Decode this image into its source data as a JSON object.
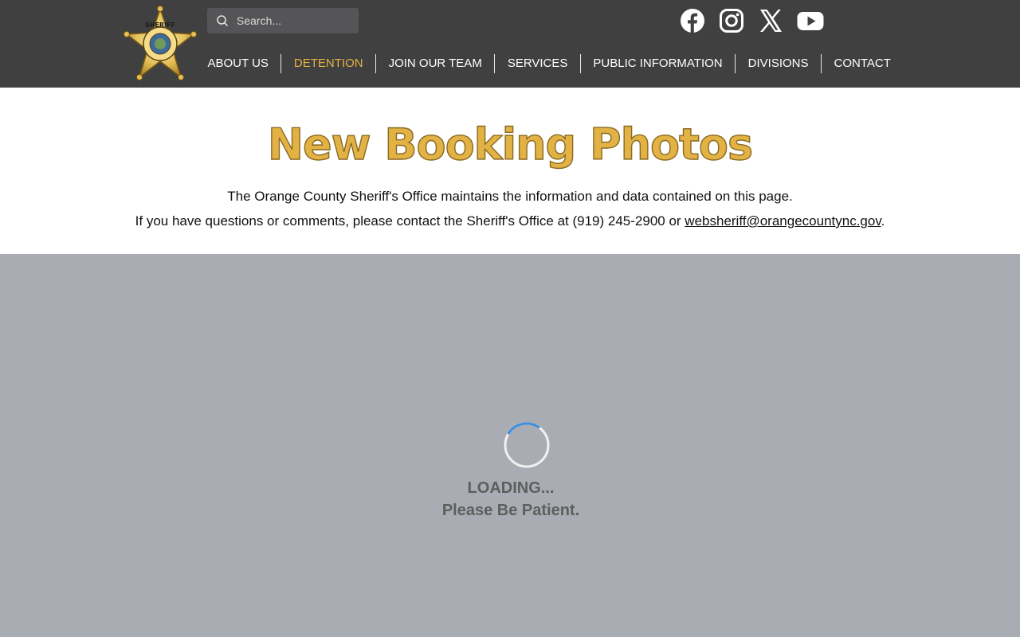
{
  "header": {
    "search": {
      "placeholder": "Search..."
    },
    "social": [
      "facebook-icon",
      "instagram-icon",
      "x-icon",
      "youtube-icon"
    ],
    "nav": [
      {
        "label": "ABOUT US",
        "active": false
      },
      {
        "label": "DETENTION",
        "active": true
      },
      {
        "label": "JOIN OUR TEAM",
        "active": false
      },
      {
        "label": "SERVICES",
        "active": false
      },
      {
        "label": "PUBLIC INFORMATION",
        "active": false
      },
      {
        "label": "DIVISIONS",
        "active": false
      },
      {
        "label": "CONTACT",
        "active": false
      }
    ]
  },
  "badge": {
    "top_text": "SHERIFF",
    "ring_text_top": "ORANGE COUNTY",
    "ring_text_bottom": "SHERIFF'S OFFICE"
  },
  "intro": {
    "title": "New Booking Photos",
    "line1": "The Orange County Sheriff's Office maintains the information and data contained on this page.",
    "line2_prefix": "If you have questions or comments, please contact the Sheriff's Office at (919) 245-2900 or ",
    "email": "websheriff@orangecountync.gov",
    "line2_suffix": "."
  },
  "loader": {
    "line1": "LOADING...",
    "line2": "Please Be Patient."
  },
  "colors": {
    "header_bg": "#404040",
    "accent": "#e5b143",
    "loader_bg": "#a9acb2",
    "spinner_arc": "#3b8fe0"
  }
}
